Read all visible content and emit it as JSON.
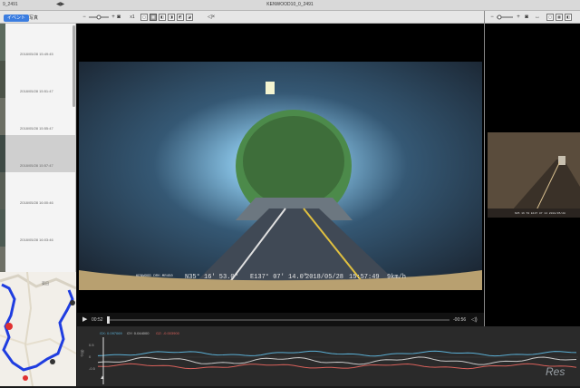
{
  "window": {
    "title": "KENWOOD10_0_2491",
    "left_label": "9_2491",
    "separator": "◀▶"
  },
  "tabs": [
    {
      "label": "イベント",
      "active": true
    },
    {
      "label": "写真",
      "active": false
    }
  ],
  "toolbar": {
    "zoom_minus": "−",
    "zoom_plus": "+",
    "speed": "x1"
  },
  "clips": [
    {
      "time": "2018/05/28 15:49:45",
      "selected": false
    },
    {
      "time": "2018/05/28 15:51:47",
      "selected": false
    },
    {
      "time": "2018/05/28 15:55:47",
      "selected": false
    },
    {
      "time": "2018/05/28 15:57:47",
      "selected": true
    },
    {
      "time": "2018/05/28 16:00:46",
      "selected": false
    },
    {
      "time": "2018/05/28 16:03:46",
      "selected": false
    }
  ],
  "map": {
    "label": "東田"
  },
  "video": {
    "osd_brand": "KENWOOD  DRV-MR450",
    "osd_lat": "N35° 16' 53.0\"",
    "osd_lon": "E137° 07' 14.0\"",
    "osd_date": "2018/05/28",
    "osd_time": "15:57:49",
    "osd_speed": "9km/h"
  },
  "playback": {
    "current": "00:52",
    "remaining": "-00:56",
    "progress_fraction": 0.0
  },
  "graph": {
    "legend": [
      {
        "label": "GX: 0.097069",
        "color": "#5bb0d6"
      },
      {
        "label": "GY: 0.044000",
        "color": "#c9c9c9"
      },
      {
        "label": "GZ: -0.003900",
        "color": "#d9615b"
      }
    ],
    "y_ticks": [
      "0.5",
      "0",
      "-0.5"
    ],
    "axis_label": "G(g)"
  },
  "watermark": "Res"
}
